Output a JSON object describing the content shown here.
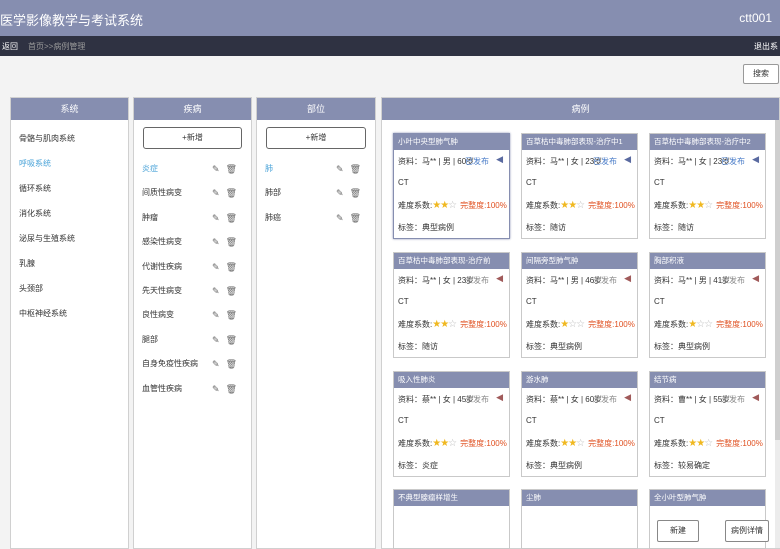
{
  "header": {
    "title": "医学影像教学与考试系统",
    "user": "ctt001"
  },
  "nav": {
    "back": "返回",
    "breadcrumb": "首页>>病例管理",
    "logout": "退出系"
  },
  "toolbar": {
    "search": "搜索"
  },
  "columns": {
    "system": "系统",
    "disease": "疾病",
    "part": "部位",
    "cases": "病例"
  },
  "systems": [
    "骨骼与肌肉系统",
    "呼吸系统",
    "循环系统",
    "消化系统",
    "泌尿与生殖系统",
    "乳腺",
    "头颈部",
    "中枢神经系统"
  ],
  "systems_active": 1,
  "add_label": "+新增",
  "diseases": [
    "炎症",
    "间质性病变",
    "肿瘤",
    "感染性病变",
    "代谢性疾病",
    "先天性病变",
    "良性病变",
    "腿部",
    "自身免疫性疾病",
    "血管性疾病"
  ],
  "parts": [
    "肺",
    "肺部",
    "肺癌"
  ],
  "case_labels": {
    "source": "资料：",
    "diff": "难度系数:",
    "comp": "完整度:",
    "tag": "标签："
  },
  "cases": [
    {
      "title": "小叶中央型肺气肿",
      "info": "马** | 男 | 60岁",
      "status": "已发布",
      "published": true,
      "modality": "CT",
      "stars": 2,
      "comp": "100%",
      "tag": "典型病例"
    },
    {
      "title": "百草枯中毒肺部表现-治疗中1",
      "info": "马** | 女 | 23岁",
      "status": "已发布",
      "published": true,
      "modality": "CT",
      "stars": 2,
      "comp": "100%",
      "tag": "随访"
    },
    {
      "title": "百草枯中毒肺部表现-治疗中2",
      "info": "马** | 女 | 23岁",
      "status": "已发布",
      "published": true,
      "modality": "CT",
      "stars": 2,
      "comp": "100%",
      "tag": "随访"
    },
    {
      "title": "百草枯中毒肺部表现-治疗前",
      "info": "马** | 女 | 23岁",
      "status": "未发布",
      "published": false,
      "modality": "CT",
      "stars": 2,
      "comp": "100%",
      "tag": "随访"
    },
    {
      "title": "间隔旁型肺气肿",
      "info": "马** | 男 | 46岁",
      "status": "未发布",
      "published": false,
      "modality": "CT",
      "stars": 1,
      "comp": "100%",
      "tag": "典型病例"
    },
    {
      "title": "胸部积液",
      "info": "马** | 男 | 41岁",
      "status": "未发布",
      "published": false,
      "modality": "CT",
      "stars": 1,
      "comp": "100%",
      "tag": "典型病例"
    },
    {
      "title": "吸入性肺炎",
      "info": "蔡** | 女 | 45岁",
      "status": "未发布",
      "published": false,
      "modality": "CT",
      "stars": 2,
      "comp": "100%",
      "tag": "炎症"
    },
    {
      "title": "游水肺",
      "info": "蔡** | 女 | 60岁",
      "status": "未发布",
      "published": false,
      "modality": "CT",
      "stars": 2,
      "comp": "100%",
      "tag": "典型病例"
    },
    {
      "title": "结节病",
      "info": "曹** | 女 | 55岁",
      "status": "未发布",
      "published": false,
      "modality": "CT",
      "stars": 2,
      "comp": "100%",
      "tag": "较易确定"
    },
    {
      "title": "不典型腺瘤样增生",
      "info": "",
      "status": "",
      "published": false,
      "modality": "",
      "stars": 0,
      "comp": "",
      "tag": ""
    },
    {
      "title": "尘肺",
      "info": "",
      "status": "",
      "published": false,
      "modality": "",
      "stars": 0,
      "comp": "",
      "tag": ""
    },
    {
      "title": "全小叶型肺气肿",
      "info": "",
      "status": "",
      "published": false,
      "modality": "",
      "stars": 0,
      "comp": "",
      "tag": ""
    }
  ],
  "bottom": {
    "new": "新建",
    "detail": "病例详情"
  }
}
